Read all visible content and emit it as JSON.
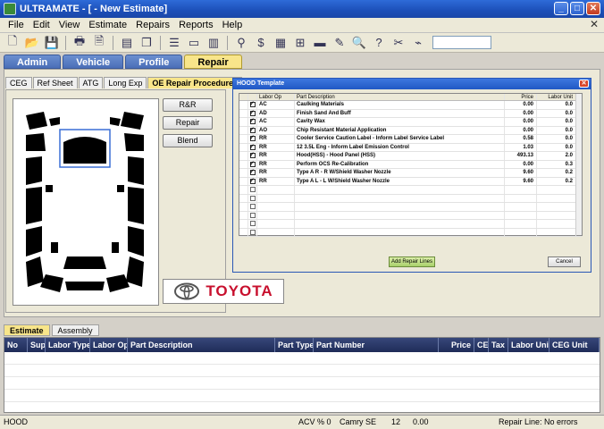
{
  "window": {
    "title": "ULTRAMATE - [ - New Estimate]",
    "min": "_",
    "max": "□",
    "close": "✕"
  },
  "menu": [
    "File",
    "Edit",
    "View",
    "Estimate",
    "Repairs",
    "Reports",
    "Help"
  ],
  "main_tabs": [
    "Admin",
    "Vehicle",
    "Profile",
    "Repair"
  ],
  "sub_tabs": [
    "CEG",
    "Ref Sheet",
    "ATG",
    "Long Exp",
    "OE Repair Procedures"
  ],
  "side_buttons": {
    "r_and_r": "R&R",
    "repair": "Repair",
    "blend": "Blend"
  },
  "brand": {
    "name": "TOYOTA",
    "color": "#c8102e"
  },
  "dialog": {
    "title": "HOOD Template",
    "columns": [
      "Labor Op",
      "Part Description",
      "Price",
      "Labor Unit"
    ],
    "rows": [
      {
        "op": "AC",
        "desc": "Caulking Materials",
        "price": "0.00",
        "unit": "0.0"
      },
      {
        "op": "AD",
        "desc": "Finish Sand And Buff",
        "price": "0.00",
        "unit": "0.0"
      },
      {
        "op": "AC",
        "desc": "Cavity Wax",
        "price": "0.00",
        "unit": "0.0"
      },
      {
        "op": "AO",
        "desc": "Chip Resistant Material Application",
        "price": "0.00",
        "unit": "0.0"
      },
      {
        "op": "RR",
        "desc": "Cooler Service Caution Label - Inform Label Service Label",
        "price": "0.58",
        "unit": "0.0"
      },
      {
        "op": "RR",
        "desc": "12 3.5L Eng - Inform Label Emission Control",
        "price": "1.03",
        "unit": "0.0"
      },
      {
        "op": "RR",
        "desc": "Hood(HSS) - Hood Panel (HSS)",
        "price": "493.13",
        "unit": "2.0"
      },
      {
        "op": "RR",
        "desc": "Perform OCS Re-Calibration",
        "price": "0.00",
        "unit": "0.3"
      },
      {
        "op": "RR",
        "desc": "Type A R - R W/Shield Washer Nozzle",
        "price": "9.60",
        "unit": "0.2"
      },
      {
        "op": "RR",
        "desc": "Type A L - L W/Shield Washer Nozzle",
        "price": "9.60",
        "unit": "0.2"
      }
    ],
    "add_button": "Add Repair Lines",
    "cancel_button": "Cancel"
  },
  "lower_tabs": [
    "Estimate",
    "Assembly"
  ],
  "estimate_columns": [
    "No",
    "Sup",
    "Labor Type",
    "Labor Op",
    "Part Description",
    "Part Type",
    "Part Number",
    "Price",
    "CE",
    "Tax",
    "Labor Unit",
    "CEG Unit"
  ],
  "status": {
    "left": "HOOD",
    "acv": "ACV % 0",
    "vehicle": "Camry SE",
    "count": "12",
    "amount": "0.00",
    "repair_line": "Repair Line: No errors"
  }
}
